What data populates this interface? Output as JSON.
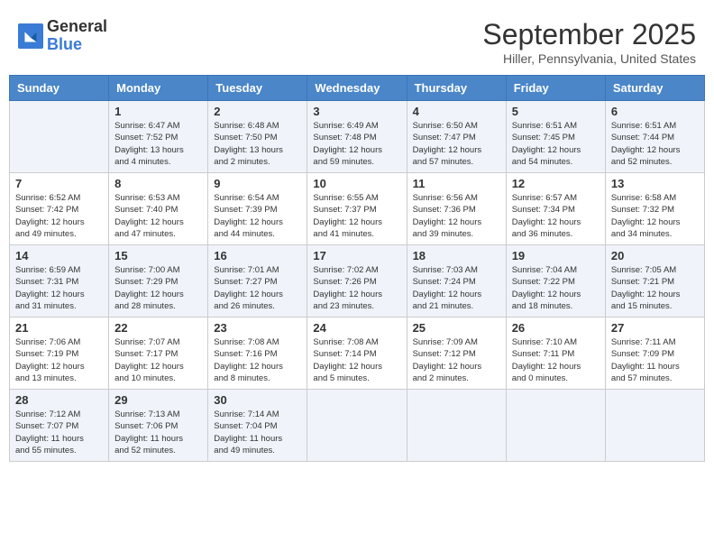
{
  "logo": {
    "general": "General",
    "blue": "Blue"
  },
  "title": "September 2025",
  "location": "Hiller, Pennsylvania, United States",
  "days_of_week": [
    "Sunday",
    "Monday",
    "Tuesday",
    "Wednesday",
    "Thursday",
    "Friday",
    "Saturday"
  ],
  "weeks": [
    [
      {
        "day": "",
        "info": ""
      },
      {
        "day": "1",
        "info": "Sunrise: 6:47 AM\nSunset: 7:52 PM\nDaylight: 13 hours\nand 4 minutes."
      },
      {
        "day": "2",
        "info": "Sunrise: 6:48 AM\nSunset: 7:50 PM\nDaylight: 13 hours\nand 2 minutes."
      },
      {
        "day": "3",
        "info": "Sunrise: 6:49 AM\nSunset: 7:48 PM\nDaylight: 12 hours\nand 59 minutes."
      },
      {
        "day": "4",
        "info": "Sunrise: 6:50 AM\nSunset: 7:47 PM\nDaylight: 12 hours\nand 57 minutes."
      },
      {
        "day": "5",
        "info": "Sunrise: 6:51 AM\nSunset: 7:45 PM\nDaylight: 12 hours\nand 54 minutes."
      },
      {
        "day": "6",
        "info": "Sunrise: 6:51 AM\nSunset: 7:44 PM\nDaylight: 12 hours\nand 52 minutes."
      }
    ],
    [
      {
        "day": "7",
        "info": "Sunrise: 6:52 AM\nSunset: 7:42 PM\nDaylight: 12 hours\nand 49 minutes."
      },
      {
        "day": "8",
        "info": "Sunrise: 6:53 AM\nSunset: 7:40 PM\nDaylight: 12 hours\nand 47 minutes."
      },
      {
        "day": "9",
        "info": "Sunrise: 6:54 AM\nSunset: 7:39 PM\nDaylight: 12 hours\nand 44 minutes."
      },
      {
        "day": "10",
        "info": "Sunrise: 6:55 AM\nSunset: 7:37 PM\nDaylight: 12 hours\nand 41 minutes."
      },
      {
        "day": "11",
        "info": "Sunrise: 6:56 AM\nSunset: 7:36 PM\nDaylight: 12 hours\nand 39 minutes."
      },
      {
        "day": "12",
        "info": "Sunrise: 6:57 AM\nSunset: 7:34 PM\nDaylight: 12 hours\nand 36 minutes."
      },
      {
        "day": "13",
        "info": "Sunrise: 6:58 AM\nSunset: 7:32 PM\nDaylight: 12 hours\nand 34 minutes."
      }
    ],
    [
      {
        "day": "14",
        "info": "Sunrise: 6:59 AM\nSunset: 7:31 PM\nDaylight: 12 hours\nand 31 minutes."
      },
      {
        "day": "15",
        "info": "Sunrise: 7:00 AM\nSunset: 7:29 PM\nDaylight: 12 hours\nand 28 minutes."
      },
      {
        "day": "16",
        "info": "Sunrise: 7:01 AM\nSunset: 7:27 PM\nDaylight: 12 hours\nand 26 minutes."
      },
      {
        "day": "17",
        "info": "Sunrise: 7:02 AM\nSunset: 7:26 PM\nDaylight: 12 hours\nand 23 minutes."
      },
      {
        "day": "18",
        "info": "Sunrise: 7:03 AM\nSunset: 7:24 PM\nDaylight: 12 hours\nand 21 minutes."
      },
      {
        "day": "19",
        "info": "Sunrise: 7:04 AM\nSunset: 7:22 PM\nDaylight: 12 hours\nand 18 minutes."
      },
      {
        "day": "20",
        "info": "Sunrise: 7:05 AM\nSunset: 7:21 PM\nDaylight: 12 hours\nand 15 minutes."
      }
    ],
    [
      {
        "day": "21",
        "info": "Sunrise: 7:06 AM\nSunset: 7:19 PM\nDaylight: 12 hours\nand 13 minutes."
      },
      {
        "day": "22",
        "info": "Sunrise: 7:07 AM\nSunset: 7:17 PM\nDaylight: 12 hours\nand 10 minutes."
      },
      {
        "day": "23",
        "info": "Sunrise: 7:08 AM\nSunset: 7:16 PM\nDaylight: 12 hours\nand 8 minutes."
      },
      {
        "day": "24",
        "info": "Sunrise: 7:08 AM\nSunset: 7:14 PM\nDaylight: 12 hours\nand 5 minutes."
      },
      {
        "day": "25",
        "info": "Sunrise: 7:09 AM\nSunset: 7:12 PM\nDaylight: 12 hours\nand 2 minutes."
      },
      {
        "day": "26",
        "info": "Sunrise: 7:10 AM\nSunset: 7:11 PM\nDaylight: 12 hours\nand 0 minutes."
      },
      {
        "day": "27",
        "info": "Sunrise: 7:11 AM\nSunset: 7:09 PM\nDaylight: 11 hours\nand 57 minutes."
      }
    ],
    [
      {
        "day": "28",
        "info": "Sunrise: 7:12 AM\nSunset: 7:07 PM\nDaylight: 11 hours\nand 55 minutes."
      },
      {
        "day": "29",
        "info": "Sunrise: 7:13 AM\nSunset: 7:06 PM\nDaylight: 11 hours\nand 52 minutes."
      },
      {
        "day": "30",
        "info": "Sunrise: 7:14 AM\nSunset: 7:04 PM\nDaylight: 11 hours\nand 49 minutes."
      },
      {
        "day": "",
        "info": ""
      },
      {
        "day": "",
        "info": ""
      },
      {
        "day": "",
        "info": ""
      },
      {
        "day": "",
        "info": ""
      }
    ]
  ]
}
